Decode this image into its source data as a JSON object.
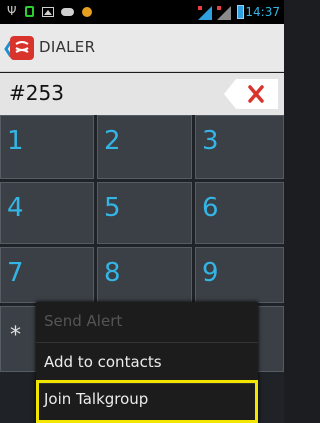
{
  "status_bar": {
    "time": "14:37",
    "icons": [
      "usb-icon",
      "notification-icon",
      "image-icon",
      "cloud-icon",
      "dot-icon",
      "signal-icon",
      "signal-icon",
      "battery-icon"
    ]
  },
  "action_bar": {
    "title": "DIALER",
    "back_icon": "chevron-left-icon",
    "app_icon": "app-logo-icon"
  },
  "number_field": {
    "value": "#253",
    "delete_icon": "close-icon"
  },
  "keypad": {
    "keys": [
      "1",
      "2",
      "3",
      "4",
      "5",
      "6",
      "7",
      "8",
      "9",
      "*"
    ]
  },
  "popup_menu": {
    "items": [
      {
        "label": "Send Alert",
        "enabled": false
      },
      {
        "label": "Add to contacts",
        "enabled": true
      },
      {
        "label": "Join Talkgroup",
        "enabled": true,
        "highlighted": true
      }
    ]
  },
  "colors": {
    "accent": "#33b5e5",
    "highlight": "#f2e600",
    "delete": "#d9342b"
  }
}
